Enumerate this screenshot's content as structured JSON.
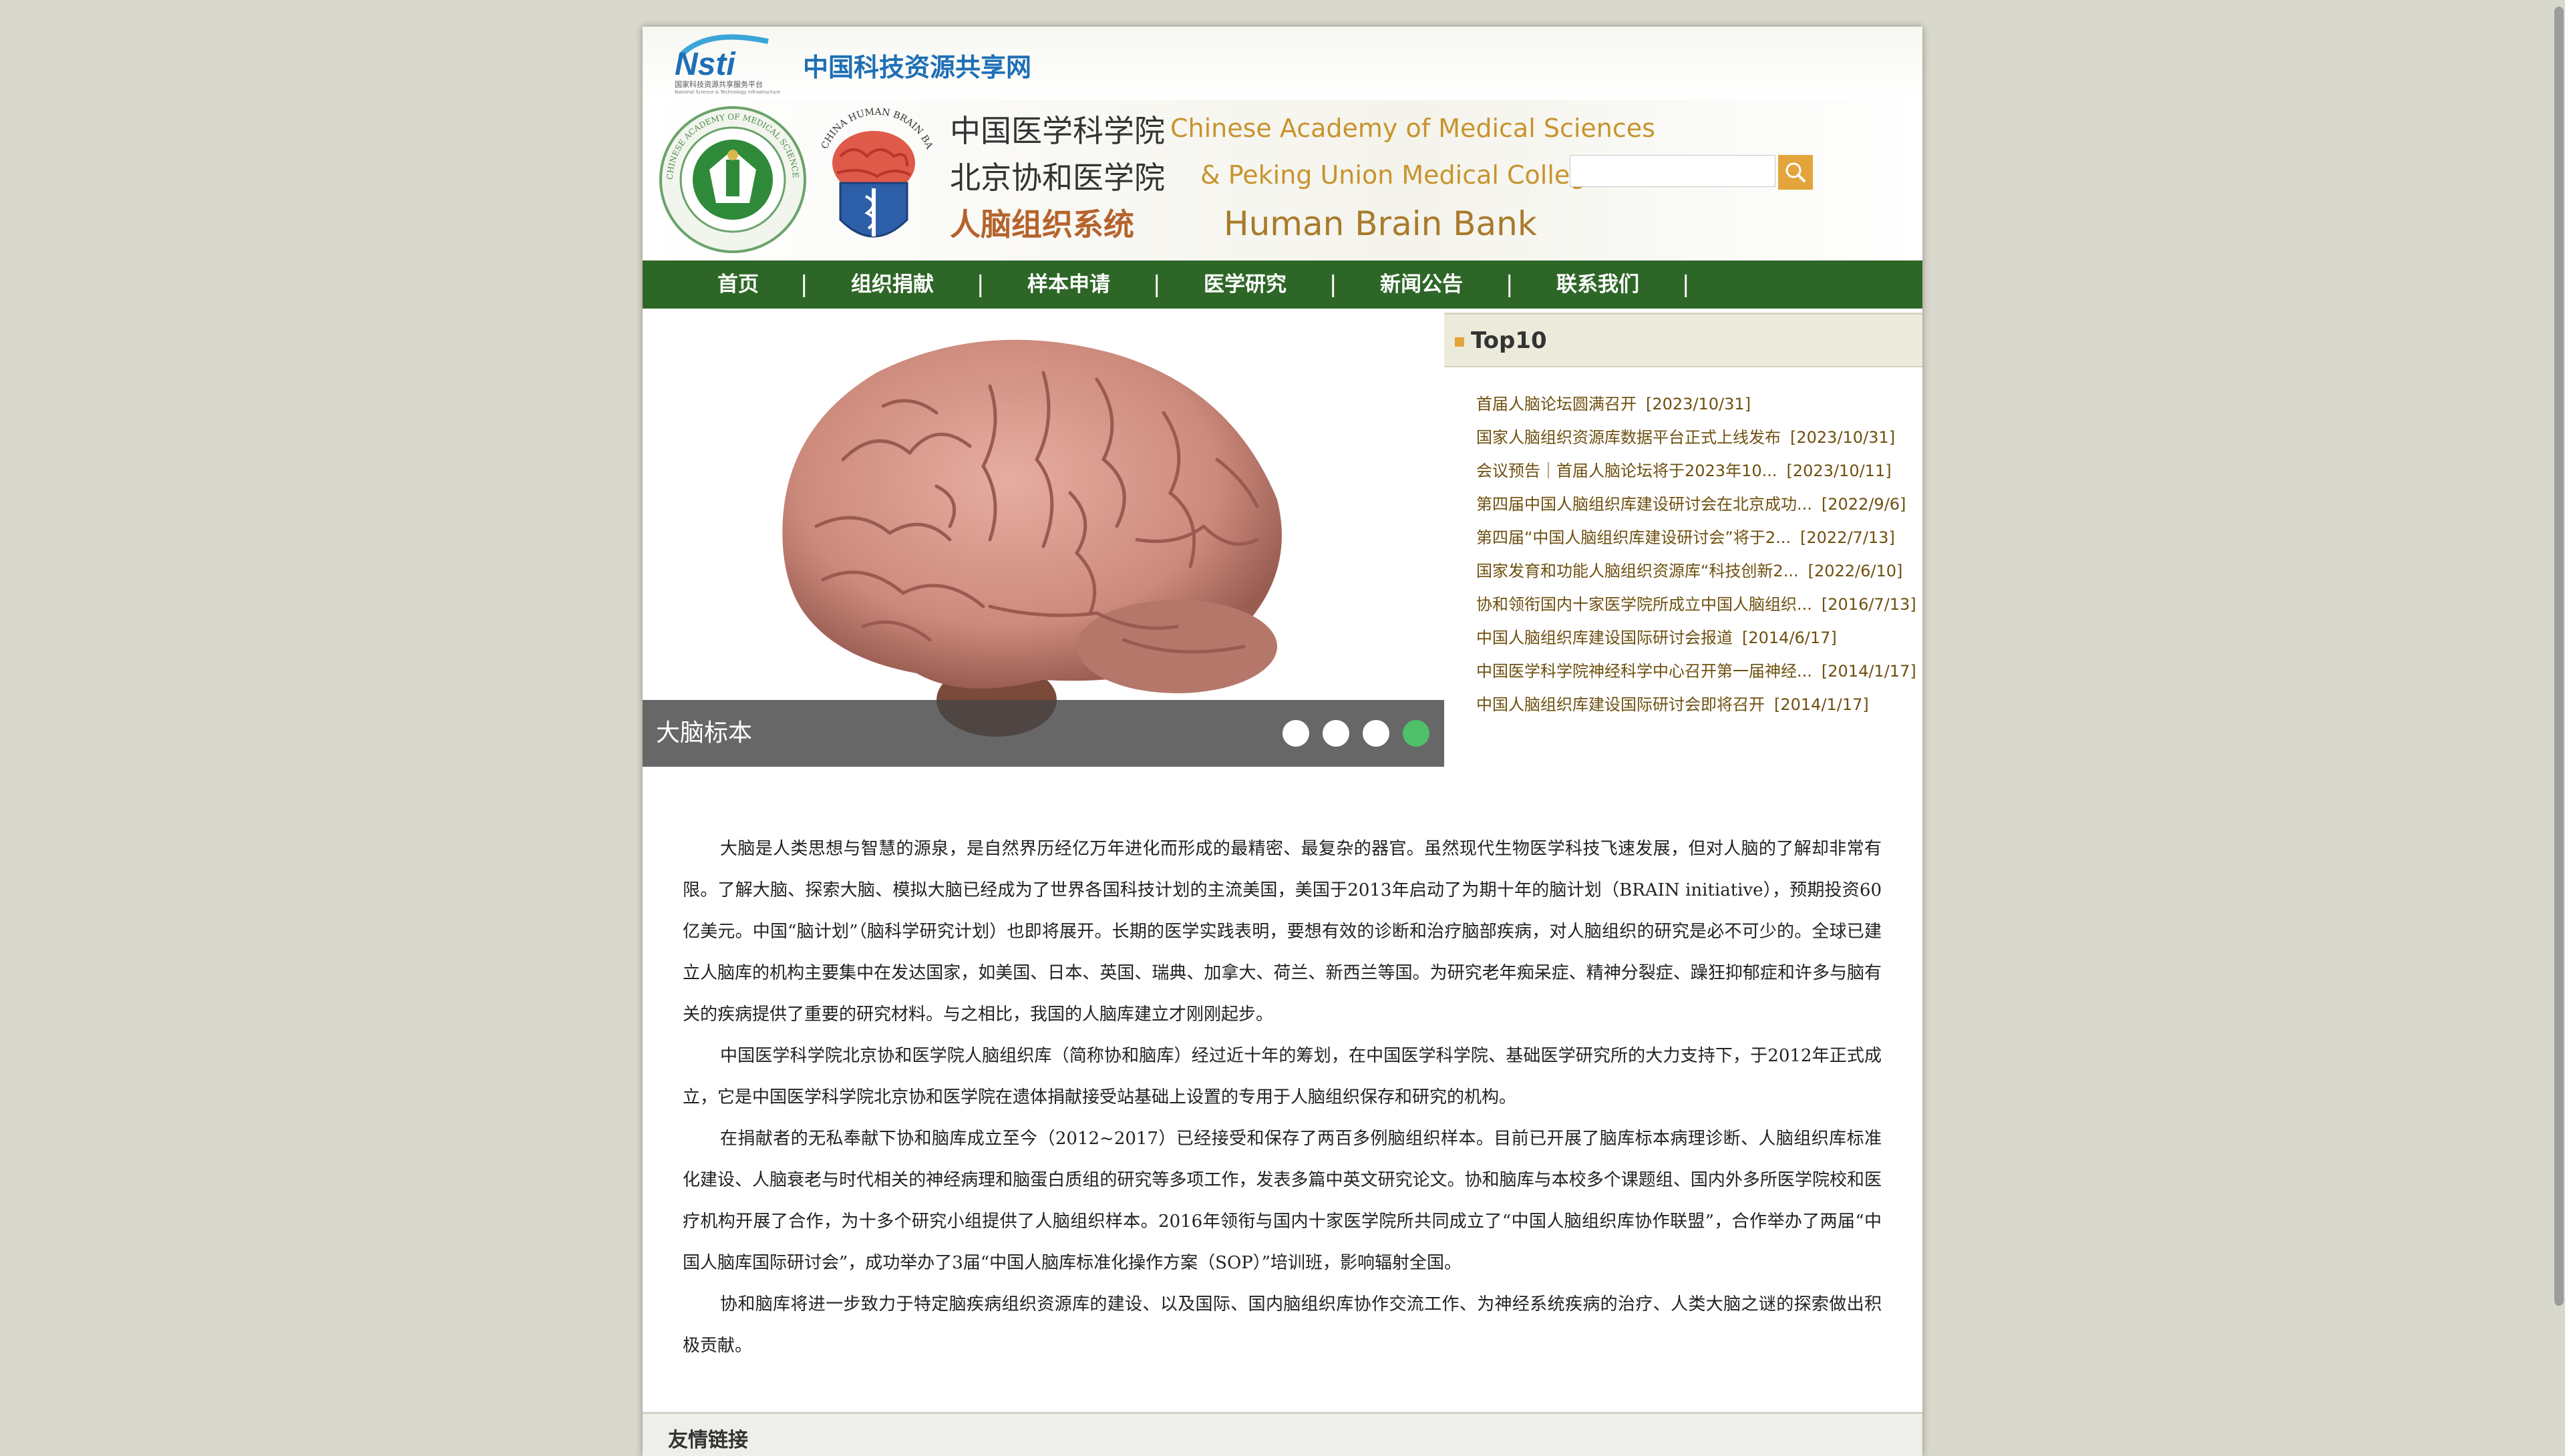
{
  "nsti": {
    "logo_text": "Nsti",
    "logo_subtext": "国家科技资源共享服务平台",
    "logo_subtext_en": "National Science & Technology Infrastructure",
    "title": "中国科技资源共享网"
  },
  "banner": {
    "cn_line1": "中国医学科学院",
    "cn_line2": "北京协和医学院",
    "cn_line3": "人脑组织系统",
    "en_line1": "Chinese Academy of Medical Sciences",
    "en_line2": "& Peking Union Medical College",
    "en_line3": "Human Brain Bank",
    "seal_text": "CHINESE ACADEMY OF MEDICAL SCIENCES · PEKING UNION MEDICAL COLLEGE",
    "shield_text": "CHINA HUMAN BRAIN BANK"
  },
  "search": {
    "placeholder": "",
    "value": ""
  },
  "nav": {
    "items": [
      "首页",
      "组织捐献",
      "样本申请",
      "医学研究",
      "新闻公告",
      "联系我们"
    ],
    "separator": "|"
  },
  "slider": {
    "caption": "大脑标本",
    "dot_count": 4,
    "active_dot": 4
  },
  "top10": {
    "title": "Top10",
    "items": [
      {
        "title": "首届人脑论坛圆满召开",
        "date": "[2023/10/31]"
      },
      {
        "title": "国家人脑组织资源库数据平台正式上线发布",
        "date": "[2023/10/31]"
      },
      {
        "title": "会议预告｜首届人脑论坛将于2023年10...",
        "date": "[2023/10/11]"
      },
      {
        "title": "第四届中国人脑组织库建设研讨会在北京成功...",
        "date": "[2022/9/6]"
      },
      {
        "title": "第四届“中国人脑组织库建设研讨会”将于2...",
        "date": "[2022/7/13]"
      },
      {
        "title": "国家发育和功能人脑组织资源库“科技创新2...",
        "date": "[2022/6/10]"
      },
      {
        "title": "协和领衔国内十家医学院所成立中国人脑组织...",
        "date": "[2016/7/13]"
      },
      {
        "title": "中国人脑组织库建设国际研讨会报道",
        "date": "[2014/6/17]"
      },
      {
        "title": "中国医学科学院神经科学中心召开第一届神经...",
        "date": "[2014/1/17]"
      },
      {
        "title": "中国人脑组织库建设国际研讨会即将召开",
        "date": "[2014/1/17]"
      }
    ]
  },
  "intro": {
    "paragraphs": [
      "大脑是人类思想与智慧的源泉，是自然界历经亿万年进化而形成的最精密、最复杂的器官。虽然现代生物医学科技飞速发展，但对人脑的了解却非常有限。了解大脑、探索大脑、模拟大脑已经成为了世界各国科技计划的主流美国，美国于2013年启动了为期十年的脑计划（BRAIN initiative），预期投资60亿美元。中国“脑计划”（脑科学研究计划）也即将展开。长期的医学实践表明，要想有效的诊断和治疗脑部疾病，对人脑组织的研究是必不可少的。全球已建立人脑库的机构主要集中在发达国家，如美国、日本、英国、瑞典、加拿大、荷兰、新西兰等国。为研究老年痴呆症、精神分裂症、躁狂抑郁症和许多与脑有关的疾病提供了重要的研究材料。与之相比，我国的人脑库建立才刚刚起步。",
      "中国医学科学院北京协和医学院人脑组织库（简称协和脑库）经过近十年的筹划，在中国医学科学院、基础医学研究所的大力支持下，于2012年正式成立，它是中国医学科学院北京协和医学院在遗体捐献接受站基础上设置的专用于人脑组织保存和研究的机构。",
      "在捐献者的无私奉献下协和脑库成立至今（2012~2017）已经接受和保存了两百多例脑组织样本。目前已开展了脑库标本病理诊断、人脑组织库标准化建设、人脑衰老与时代相关的神经病理和脑蛋白质组的研究等多项工作，发表多篇中英文研究论文。协和脑库与本校多个课题组、国内外多所医学院校和医疗机构开展了合作，为十多个研究小组提供了人脑组织样本。2016年领衔与国内十家医学院所共同成立了“中国人脑组织库协作联盟”，合作举办了两届“中国人脑库国际研讨会”，成功举办了3届“中国人脑库标准化操作方案（SOP）”培训班，影响辐射全国。",
      "协和脑库将进一步致力于特定脑疾病组织资源库的建设、以及国际、国内脑组织库协作交流工作、为神经系统疾病的治疗、人类大脑之谜的探索做出积极贡献。"
    ]
  },
  "footer": {
    "links_title": "友情链接"
  },
  "icons": {
    "search": "search-icon"
  },
  "colors": {
    "nav_bg": "#2e6627",
    "accent": "#e3a43b",
    "dot_active": "#4fc06a",
    "link": "#6e5010"
  }
}
